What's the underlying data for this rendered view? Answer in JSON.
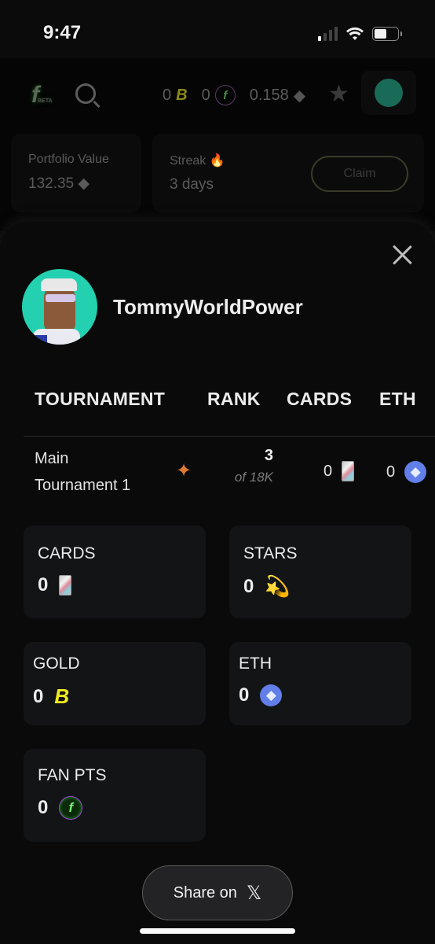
{
  "status_bar": {
    "time": "9:47"
  },
  "background_app": {
    "logo_text": "f",
    "logo_badge": "BETA",
    "balances": {
      "gold": "0",
      "fan_points": "0",
      "eth": "0.158"
    },
    "portfolio": {
      "label": "Portfolio Value",
      "value": "132.35"
    },
    "streak": {
      "label": "Streak",
      "value": "3 days",
      "claim_label": "Claim"
    }
  },
  "modal": {
    "username": "TommyWorldPower",
    "table": {
      "headers": [
        "TOURNAMENT",
        "RANK",
        "CARDS",
        "ETH"
      ],
      "rows": [
        {
          "tournament_line1": "Main",
          "tournament_line2": "Tournament 1",
          "rank": "3",
          "rank_of": "of 18K",
          "cards": "0",
          "eth": "0"
        }
      ]
    },
    "stats": {
      "cards": {
        "label": "CARDS",
        "value": "0"
      },
      "stars": {
        "label": "STARS",
        "value": "0"
      },
      "gold": {
        "label": "GOLD",
        "value": "0"
      },
      "eth": {
        "label": "ETH",
        "value": "0"
      },
      "fan_pts": {
        "label": "FAN PTS",
        "value": "0"
      }
    },
    "share_label": "Share on"
  },
  "colors": {
    "accent_gold": "#f3ec1c",
    "eth_blue": "#627ee8",
    "avatar_teal": "#23d1b0",
    "spark_orange": "#e07a34"
  }
}
